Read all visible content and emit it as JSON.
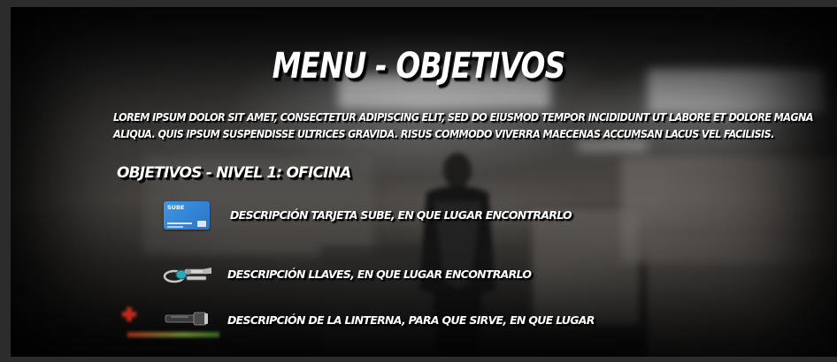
{
  "menu": {
    "title": "MENU - OBJETIVOS",
    "intro": "LOREM IPSUM DOLOR SIT AMET, CONSECTETUR ADIPISCING ELIT, SED DO EIUSMOD TEMPOR INCIDIDUNT UT LABORE ET DOLORE MAGNA ALIQUA. QUIS IPSUM SUSPENDISSE ULTRICES GRAVIDA. RISUS COMMODO VIVERRA MAECENAS ACCUMSAN LACUS VEL FACILISIS.",
    "section_title": "OBJETIVOS - NIVEL 1: OFICINA"
  },
  "objectives": [
    {
      "icon": "sube-card-icon",
      "card_label": "SUBE",
      "text": "DESCRIPCIÓN TARJETA SUBE, EN QUE LUGAR ENCONTRARLO"
    },
    {
      "icon": "keys-icon",
      "text": "DESCRIPCIÓN LLAVES, EN QUE LUGAR ENCONTRARLO"
    },
    {
      "icon": "flashlight-icon",
      "text": "DESCRIPCIÓN DE LA LINTERNA, PARA QUE SIRVE, EN QUE LUGAR"
    }
  ],
  "hud": {
    "health_icon": "health-cross-icon",
    "colors": {
      "health_cross": "#c22a1a",
      "card_blue": "#2f86d8"
    }
  }
}
